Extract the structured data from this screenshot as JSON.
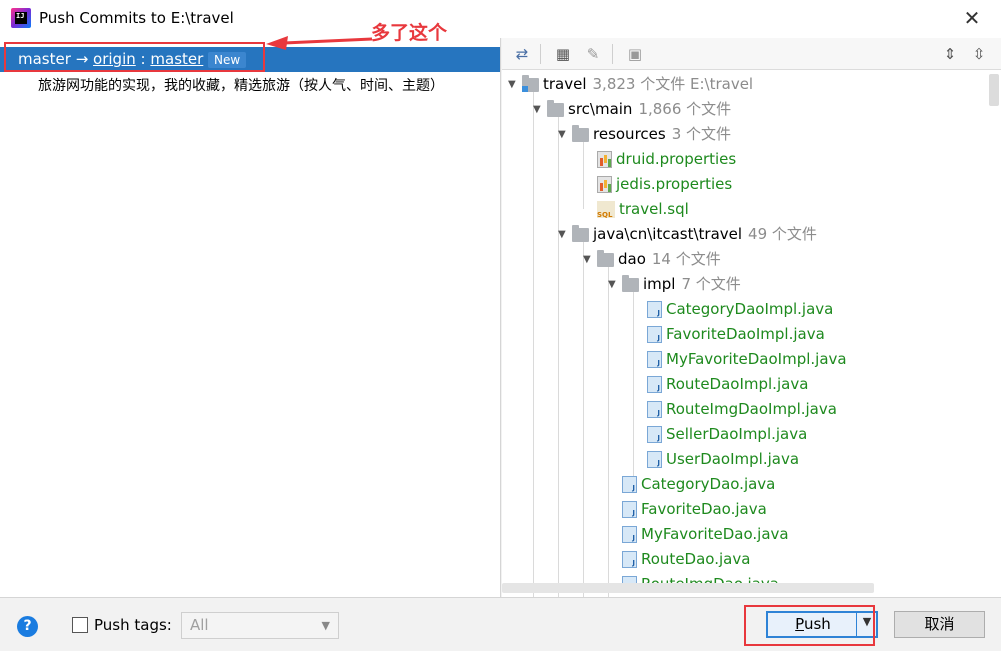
{
  "window": {
    "title": "Push Commits to E:\\travel",
    "close_glyph": "✕"
  },
  "annotation": {
    "text": "多了这个",
    "color": "#e8383d"
  },
  "branch": {
    "local": "master",
    "arrow": "→",
    "remote": "origin",
    "separator": ":",
    "remote_branch": "master",
    "badge": "New"
  },
  "commit": {
    "message": "旅游网功能的实现，我的收藏，精选旅游（按人气、时间、主题）"
  },
  "toolbar": {
    "icons": [
      "expand-collapse-icon",
      "group-by-icon",
      "edit-icon",
      "preview-icon",
      "expand-all-icon",
      "collapse-all-icon"
    ]
  },
  "tree": [
    {
      "name": "travel",
      "count": "3,823 个文件  E:\\travel",
      "type": "folder-mod",
      "expanded": true
    },
    {
      "name": "src\\main",
      "count": "1,866 个文件",
      "type": "folder",
      "expanded": true
    },
    {
      "name": "resources",
      "count": "3 个文件",
      "type": "folder",
      "expanded": true
    },
    {
      "name": "druid.properties",
      "count": "",
      "type": "props"
    },
    {
      "name": "jedis.properties",
      "count": "",
      "type": "props"
    },
    {
      "name": "travel.sql",
      "count": "",
      "type": "sql"
    },
    {
      "name": "java\\cn\\itcast\\travel",
      "count": "49 个文件",
      "type": "folder",
      "expanded": true
    },
    {
      "name": "dao",
      "count": "14 个文件",
      "type": "folder",
      "expanded": true
    },
    {
      "name": "impl",
      "count": "7 个文件",
      "type": "folder",
      "expanded": true
    },
    {
      "name": "CategoryDaoImpl.java",
      "count": "",
      "type": "java"
    },
    {
      "name": "FavoriteDaoImpl.java",
      "count": "",
      "type": "java"
    },
    {
      "name": "MyFavoriteDaoImpl.java",
      "count": "",
      "type": "java"
    },
    {
      "name": "RouteDaoImpl.java",
      "count": "",
      "type": "java"
    },
    {
      "name": "RouteImgDaoImpl.java",
      "count": "",
      "type": "java"
    },
    {
      "name": "SellerDaoImpl.java",
      "count": "",
      "type": "java"
    },
    {
      "name": "UserDaoImpl.java",
      "count": "",
      "type": "java"
    },
    {
      "name": "CategoryDao.java",
      "count": "",
      "type": "java"
    },
    {
      "name": "FavoriteDao.java",
      "count": "",
      "type": "java"
    },
    {
      "name": "MyFavoriteDao.java",
      "count": "",
      "type": "java"
    },
    {
      "name": "RouteDao.java",
      "count": "",
      "type": "java"
    },
    {
      "name": "RouteImgDao.java",
      "count": "",
      "type": "java"
    }
  ],
  "bottom": {
    "help": "?",
    "push_tags_label": "Push tags:",
    "tags_select_value": "All",
    "push_label_first": "P",
    "push_label_rest": "ush",
    "cancel_label": "取消"
  }
}
